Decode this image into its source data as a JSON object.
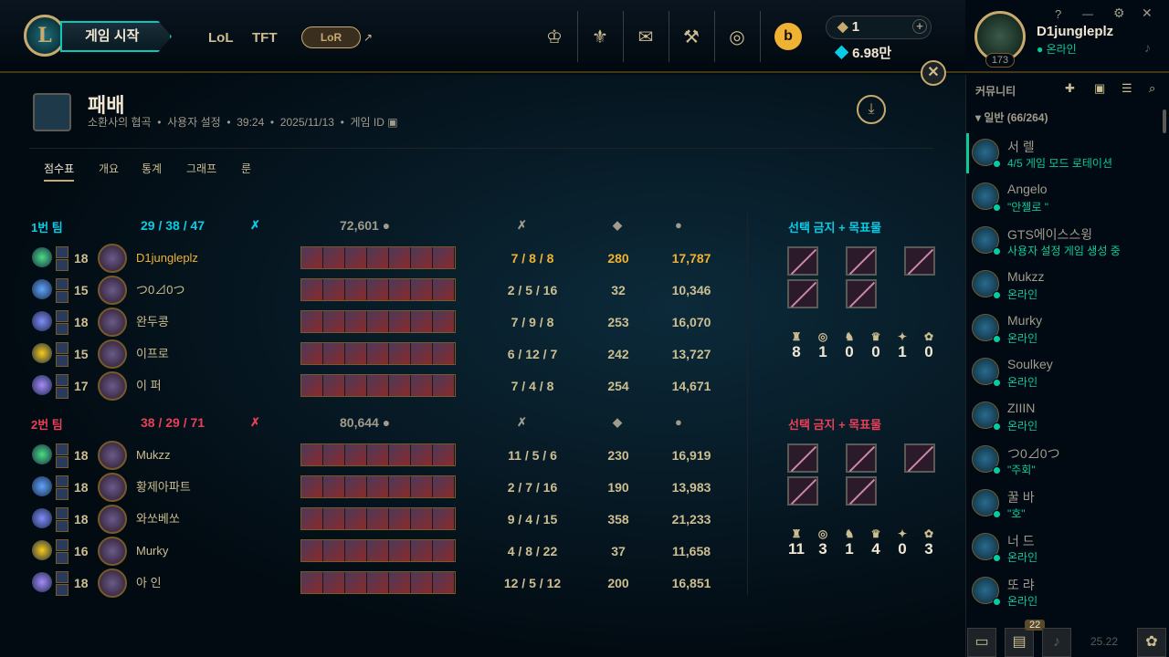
{
  "topbar": {
    "play_label": "게임 시작",
    "nav": [
      "LoL",
      "TFT"
    ],
    "lor_label": "LoR",
    "rp": "1",
    "be": "6.98만",
    "add": "+"
  },
  "profile": {
    "name": "D1jungleplz",
    "status": "온라인",
    "level": "173"
  },
  "game": {
    "result": "패배",
    "map": "소환사의 협곡",
    "mode": "사용자 설정",
    "duration": "39:24",
    "date": "2025/11/13",
    "game_id_label": "게임 ID"
  },
  "tabs": [
    "점수표",
    "개요",
    "통계",
    "그래프",
    "룬"
  ],
  "team1": {
    "name": "1번 팀",
    "kills": "29",
    "deaths": "38",
    "assists": "47",
    "gold": "72,601",
    "color": "#0acbe6",
    "bans_label": "선택 금지 + 목표물",
    "objectives": [
      "8",
      "1",
      "0",
      "0",
      "1",
      "0"
    ],
    "players": [
      {
        "level": "18",
        "name": "D1jungleplz",
        "kda": [
          "7",
          "8",
          "8"
        ],
        "cs": "280",
        "gold": "17,787",
        "highlight": true
      },
      {
        "level": "15",
        "name": "つ0⊿0つ",
        "kda": [
          "2",
          "5",
          "16"
        ],
        "cs": "32",
        "gold": "10,346"
      },
      {
        "level": "18",
        "name": "완두콩",
        "kda": [
          "7",
          "9",
          "8"
        ],
        "cs": "253",
        "gold": "16,070"
      },
      {
        "level": "15",
        "name": "이프로",
        "kda": [
          "6",
          "12",
          "7"
        ],
        "cs": "242",
        "gold": "13,727"
      },
      {
        "level": "17",
        "name": "이 퍼",
        "kda": [
          "7",
          "4",
          "8"
        ],
        "cs": "254",
        "gold": "14,671"
      }
    ]
  },
  "team2": {
    "name": "2번 팀",
    "kills": "38",
    "deaths": "29",
    "assists": "71",
    "gold": "80,644",
    "color": "#e84057",
    "bans_label": "선택 금지 + 목표물",
    "objectives": [
      "11",
      "3",
      "1",
      "4",
      "0",
      "3"
    ],
    "players": [
      {
        "level": "18",
        "name": "Mukzz",
        "kda": [
          "11",
          "5",
          "6"
        ],
        "cs": "230",
        "gold": "16,919"
      },
      {
        "level": "18",
        "name": "황제아파트",
        "kda": [
          "2",
          "7",
          "16"
        ],
        "cs": "190",
        "gold": "13,983"
      },
      {
        "level": "18",
        "name": "와쏘베쏘",
        "kda": [
          "9",
          "4",
          "15"
        ],
        "cs": "358",
        "gold": "21,233"
      },
      {
        "level": "16",
        "name": "Murky",
        "kda": [
          "4",
          "8",
          "22"
        ],
        "cs": "37",
        "gold": "11,658"
      },
      {
        "level": "18",
        "name": "아 인",
        "kda": [
          "12",
          "5",
          "12"
        ],
        "cs": "200",
        "gold": "16,851"
      }
    ]
  },
  "social": {
    "title": "커뮤니티",
    "group": "일반 (66/264)",
    "friends": [
      {
        "name": "서 렐",
        "status": "4/5 게임 모드 로테이션"
      },
      {
        "name": "Angelo",
        "status": "\"안젤로 \""
      },
      {
        "name": "GTS에이스스윙",
        "status": "사용자 설정 게임 생성 중"
      },
      {
        "name": "Mukzz",
        "status": "온라인"
      },
      {
        "name": "Murky",
        "status": "온라인"
      },
      {
        "name": "Soulkey",
        "status": "온라인"
      },
      {
        "name": "ZIIIN",
        "status": "온라인"
      },
      {
        "name": "つ0⊿0つ",
        "status": "\"주회\""
      },
      {
        "name": "꿀 바",
        "status": "\"호\""
      },
      {
        "name": "너 드",
        "status": "온라인"
      },
      {
        "name": "또 랴",
        "status": "온라인"
      }
    ],
    "badge": "22",
    "version": "25.22"
  }
}
